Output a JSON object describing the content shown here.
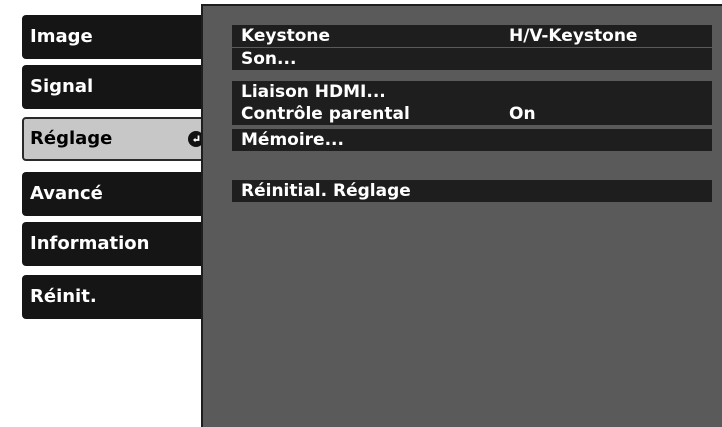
{
  "menu": {
    "tabs": [
      {
        "label": "Image"
      },
      {
        "label": "Signal"
      },
      {
        "label": "Réglage"
      },
      {
        "label": "Avancé"
      },
      {
        "label": "Information"
      },
      {
        "label": "Réinit."
      }
    ],
    "selected_index": 2
  },
  "settings": {
    "rows": [
      {
        "label": "Keystone",
        "value": "H/V-Keystone"
      },
      {
        "label": "Son..."
      },
      {
        "label": "Liaison HDMI..."
      },
      {
        "label": "Contrôle parental",
        "value": "On"
      },
      {
        "label": "Mémoire..."
      },
      {
        "label": "Réinitial. Réglage"
      }
    ]
  },
  "colors": {
    "tab_background": "#151515",
    "tab_selected_background": "#c7c7c7",
    "panel_background": "#5a5a5a",
    "row_background": "#1e1e1e",
    "text": "#ffffff"
  },
  "icons": {
    "selected_tab_icon": "enter-icon"
  }
}
